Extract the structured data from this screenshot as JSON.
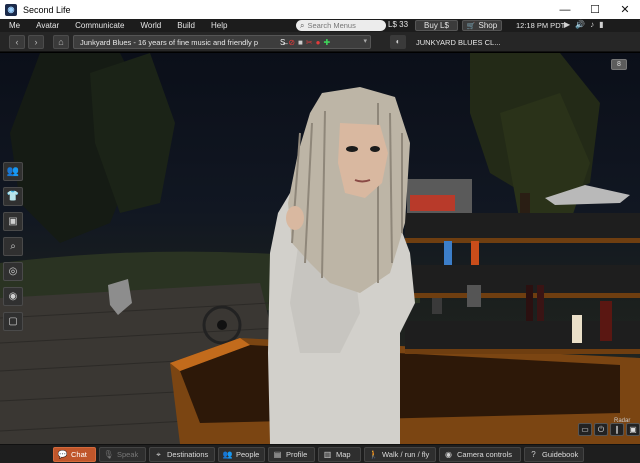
{
  "window": {
    "title": "Second Life",
    "controls": [
      "minimize",
      "maximize",
      "close"
    ]
  },
  "menubar": {
    "items": [
      "Me",
      "Avatar",
      "Communicate",
      "World",
      "Build",
      "Help"
    ],
    "search_placeholder": "Search Menus",
    "balance": "L$ 33",
    "buy_label": "Buy L$",
    "shop_label": "Shop",
    "clock": "12:18 PM PDT"
  },
  "navbar": {
    "location": "Junkyard Blues - 16 years of fine music and friendly p",
    "favorite_landmark": "JUNKYARD BLUES CL..."
  },
  "bottom_toolbar": {
    "chat": "Chat",
    "speak": "Speak",
    "destinations": "Destinations",
    "people": "People",
    "profile": "Profile",
    "map": "Map",
    "walk": "Walk / run / fly",
    "camera": "Camera controls",
    "guidebook": "Guidebook"
  },
  "viewport": {
    "radar_label": "Radar"
  },
  "icons": {
    "left_toolbar": [
      "avatar-icon",
      "appearance-icon",
      "inventory-icon",
      "search-icon",
      "places-icon",
      "voice-icon",
      "snapshot-icon"
    ]
  },
  "colors": {
    "chat_button": "#c0562b",
    "menubar": "#1c1c1c",
    "toolbar": "#1e1e1e"
  }
}
